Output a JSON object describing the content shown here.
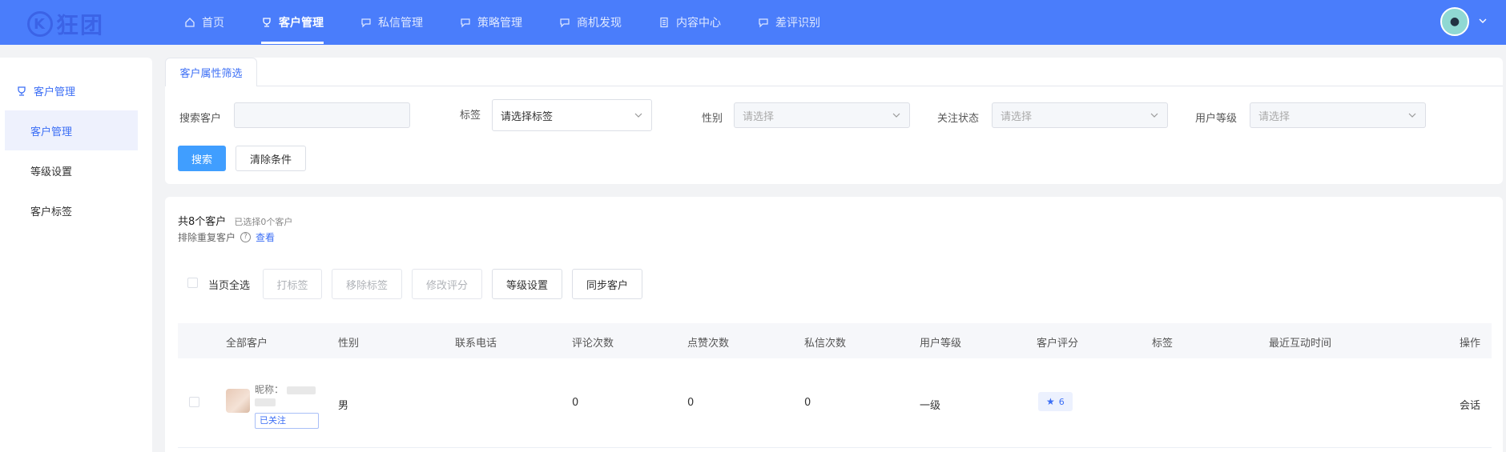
{
  "header": {
    "logo_text": "狂团",
    "nav": [
      {
        "label": "首页",
        "icon": "home-icon",
        "active": false
      },
      {
        "label": "客户管理",
        "icon": "trophy-icon",
        "active": true
      },
      {
        "label": "私信管理",
        "icon": "chat-icon",
        "active": false
      },
      {
        "label": "策略管理",
        "icon": "chat-icon",
        "active": false
      },
      {
        "label": "商机发现",
        "icon": "chat-icon",
        "active": false
      },
      {
        "label": "内容中心",
        "icon": "document-icon",
        "active": false
      },
      {
        "label": "差评识别",
        "icon": "chat-icon",
        "active": false
      }
    ]
  },
  "sidebar": {
    "group_label": "客户管理",
    "items": [
      {
        "label": "客户管理",
        "active": true
      },
      {
        "label": "等级设置",
        "active": false
      },
      {
        "label": "客户标签",
        "active": false
      }
    ]
  },
  "filter": {
    "tab_label": "客户属性筛选",
    "search_label": "搜索客户",
    "search_value": "",
    "tag_label": "标签",
    "tag_value": "请选择标签",
    "gender_label": "性别",
    "gender_placeholder": "请选择",
    "follow_label": "关注状态",
    "follow_placeholder": "请选择",
    "level_label": "用户等级",
    "level_placeholder": "请选择",
    "search_button": "搜索",
    "clear_button": "清除条件"
  },
  "list": {
    "total_text": "共8个客户",
    "selected_text": "已选择0个客户",
    "dedupe_text": "排除重复客户",
    "dedupe_link": "查看",
    "select_all_label": "当页全选",
    "actions": {
      "tag": "打标签",
      "remove_tag": "移除标签",
      "edit_score": "修改评分",
      "level_setting": "等级设置",
      "sync": "同步客户"
    },
    "columns": [
      "全部客户",
      "性别",
      "联系电话",
      "评论次数",
      "点赞次数",
      "私信次数",
      "用户等级",
      "客户评分",
      "标签",
      "最近互动时间",
      "操作"
    ],
    "rows": [
      {
        "nickname_label": "昵称：",
        "follow_status": "已关注",
        "gender": "男",
        "phone": "",
        "comments": "0",
        "likes": "0",
        "messages": "0",
        "level": "一级",
        "score": "6",
        "tags": "",
        "last_interaction": "",
        "action": "会话"
      }
    ]
  },
  "colors": {
    "topbar": "#4a7dfb",
    "accent": "#3b6ef5",
    "primary_button": "#409eff"
  }
}
